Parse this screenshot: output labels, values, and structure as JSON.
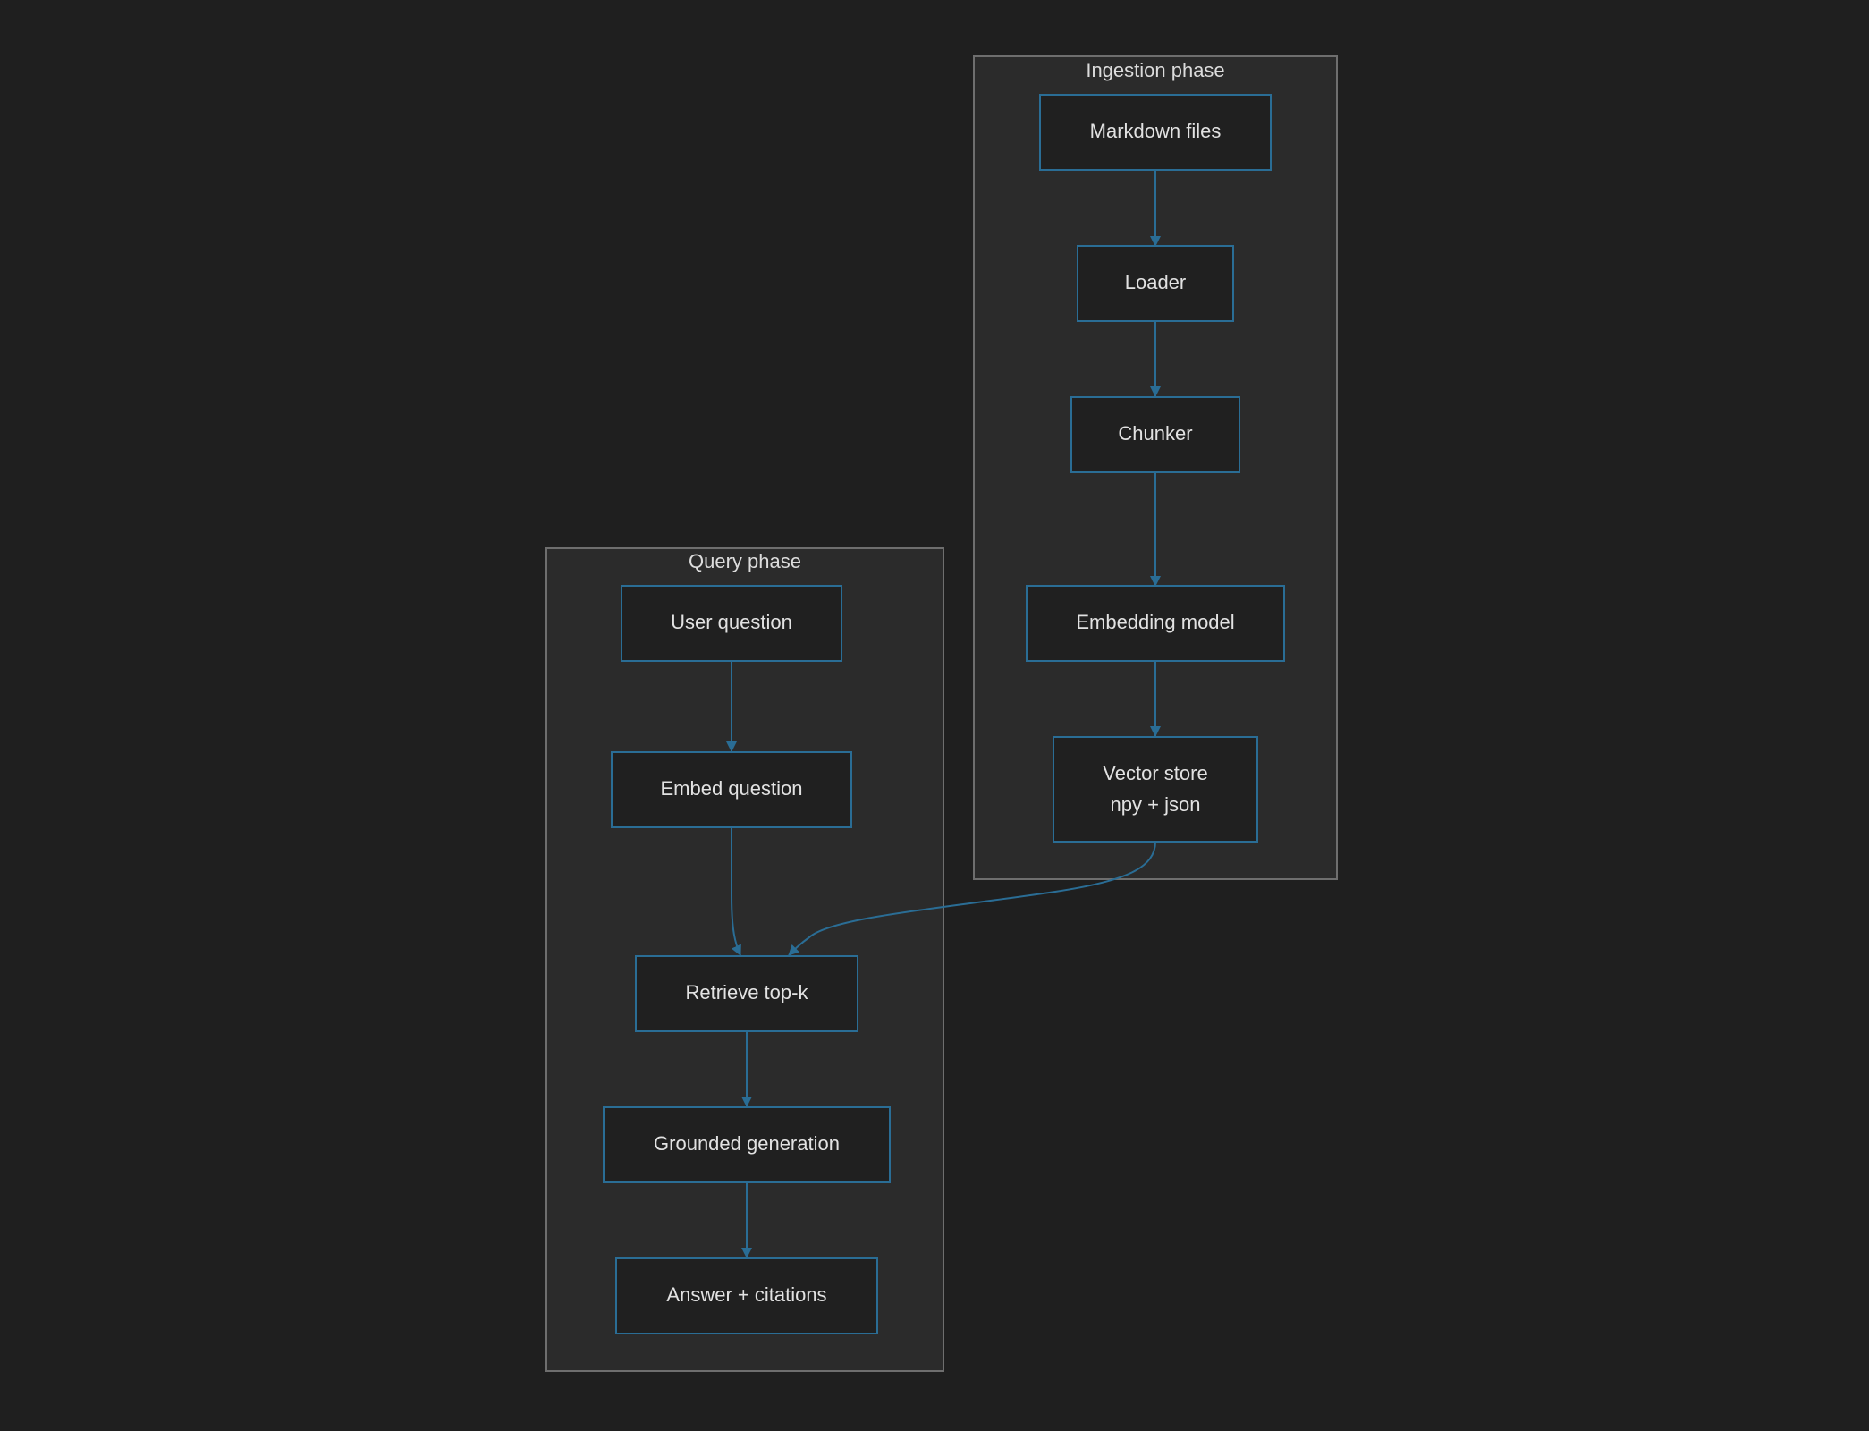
{
  "clusters": [
    {
      "id": "ingestion",
      "label": "Ingestion phase"
    },
    {
      "id": "query",
      "label": "Query phase"
    }
  ],
  "nodes": [
    {
      "id": "markdown",
      "lines": [
        "Markdown files"
      ]
    },
    {
      "id": "loader",
      "lines": [
        "Loader"
      ]
    },
    {
      "id": "chunker",
      "lines": [
        "Chunker"
      ]
    },
    {
      "id": "embedding",
      "lines": [
        "Embedding model"
      ]
    },
    {
      "id": "vectorstore",
      "lines": [
        "Vector store",
        "npy + json"
      ]
    },
    {
      "id": "userq",
      "lines": [
        "User question"
      ]
    },
    {
      "id": "embedq",
      "lines": [
        "Embed question"
      ]
    },
    {
      "id": "retrieve",
      "lines": [
        "Retrieve top-k"
      ]
    },
    {
      "id": "grounded",
      "lines": [
        "Grounded generation"
      ]
    },
    {
      "id": "answer",
      "lines": [
        "Answer + citations"
      ]
    }
  ],
  "edges": [
    {
      "from": "markdown",
      "to": "loader"
    },
    {
      "from": "loader",
      "to": "chunker"
    },
    {
      "from": "chunker",
      "to": "embedding"
    },
    {
      "from": "embedding",
      "to": "vectorstore"
    },
    {
      "from": "userq",
      "to": "embedq"
    },
    {
      "from": "embedq",
      "to": "retrieve"
    },
    {
      "from": "vectorstore",
      "to": "retrieve"
    },
    {
      "from": "retrieve",
      "to": "grounded"
    },
    {
      "from": "grounded",
      "to": "answer"
    }
  ],
  "colors": {
    "background": "#1f1f1f",
    "cluster_fill": "#2b2b2b",
    "cluster_border": "#6e6e6e",
    "node_fill": "#202020",
    "node_border": "#2a6d95",
    "edge": "#2a6d95",
    "text": "#e2e2e2"
  }
}
